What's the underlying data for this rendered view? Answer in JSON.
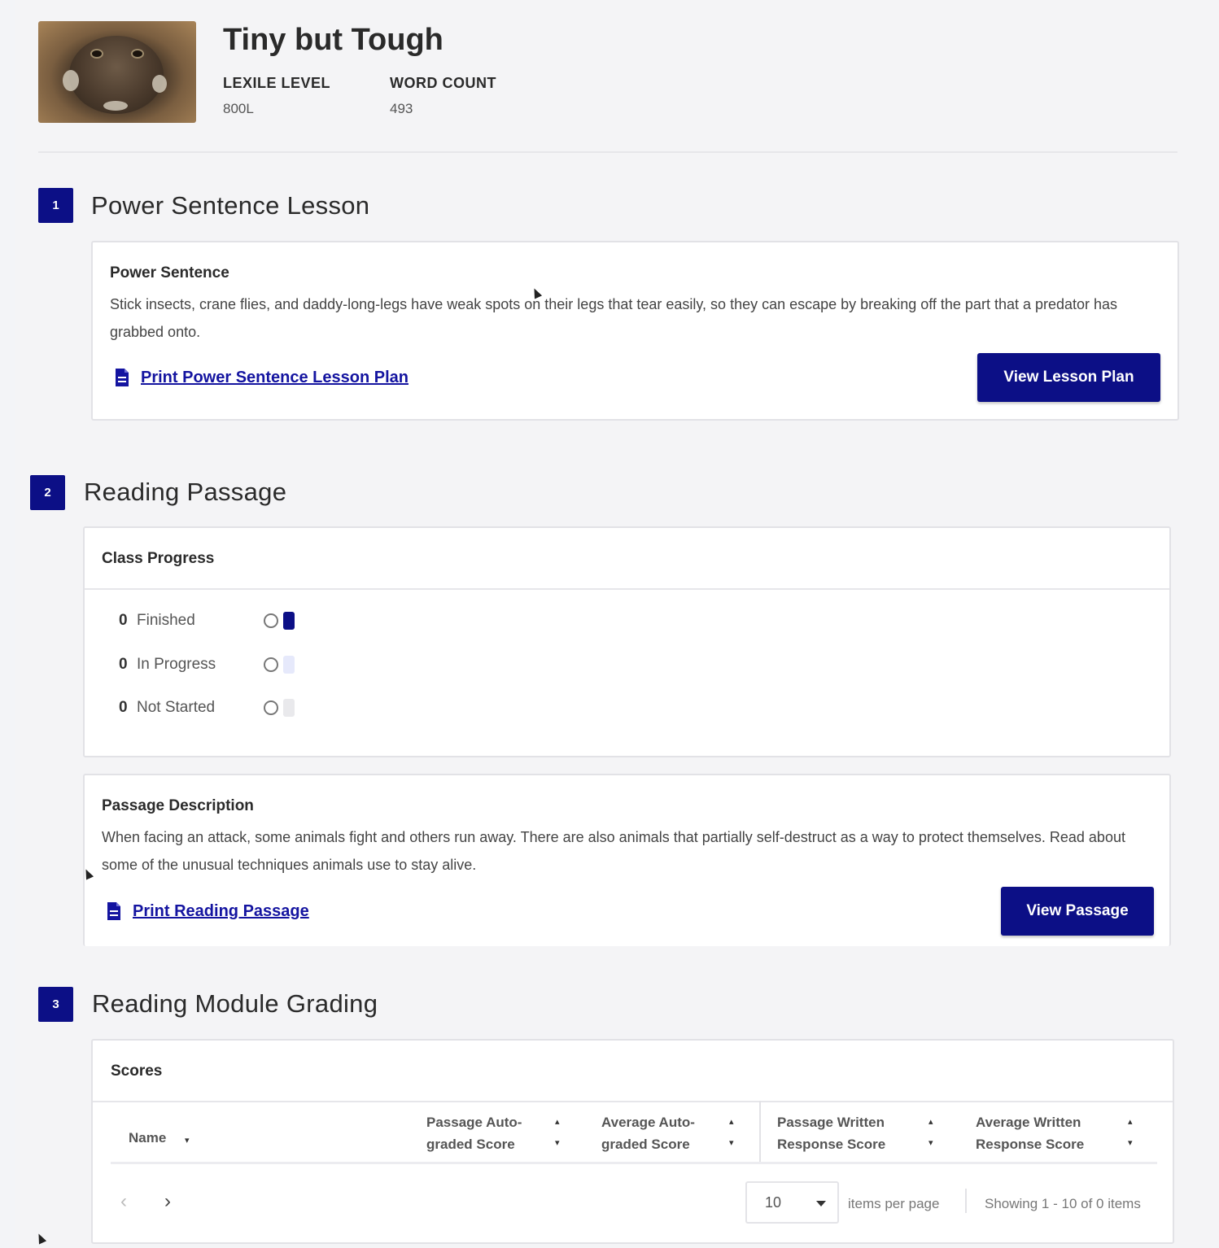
{
  "header": {
    "title": "Tiny but Tough",
    "lexile_label": "LEXILE LEVEL",
    "lexile_value": "800L",
    "word_count_label": "WORD COUNT",
    "word_count_value": "493",
    "image_alt": "frog photo"
  },
  "sections": {
    "s1": {
      "number": "1",
      "title": "Power Sentence Lesson",
      "card_heading": "Power Sentence",
      "card_text": "Stick insects, crane flies, and daddy-long-legs have weak spots on their legs that tear easily, so they can escape by breaking off the part that a predator has grabbed onto.",
      "print_link": "Print Power Sentence Lesson Plan",
      "button": "View Lesson Plan"
    },
    "s2": {
      "number": "2",
      "title": "Reading Passage",
      "progress_heading": "Class Progress",
      "progress": [
        {
          "count": "0",
          "label": "Finished",
          "color": "#0c0f86"
        },
        {
          "count": "0",
          "label": "In Progress",
          "color": "#e6e9fb"
        },
        {
          "count": "0",
          "label": "Not Started",
          "color": "#e9e9ec"
        }
      ],
      "description_heading": "Passage Description",
      "description_text": "When facing an attack, some animals fight and others run away. There are also animals that partially self-destruct as a way to protect themselves. Read about some of the unusual techniques animals use to stay alive.",
      "print_link": "Print Reading Passage",
      "button": "View Passage"
    },
    "s3": {
      "number": "3",
      "title": "Reading Module Grading",
      "card_heading": "Scores",
      "columns": [
        {
          "line1": "Name",
          "line2": ""
        },
        {
          "line1": "Passage Auto-",
          "line2": "graded Score"
        },
        {
          "line1": "Average Auto-",
          "line2": "graded Score"
        },
        {
          "line1": "Passage Written",
          "line2": "Response Score"
        },
        {
          "line1": "Average Written",
          "line2": "Response Score"
        }
      ],
      "pager": {
        "prev": "‹",
        "next": "›",
        "per_page_value": "10",
        "per_page_label": "items per page",
        "showing": "Showing 1 - 10 of 0 items"
      }
    }
  },
  "colors": {
    "accent": "#0c0f86",
    "link": "#1414a0"
  },
  "icons": {
    "doc": "document-icon",
    "info": "info-icon",
    "sort": "sort-icon"
  }
}
